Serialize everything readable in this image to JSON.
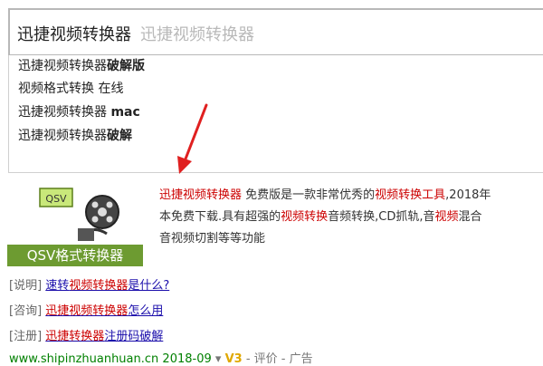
{
  "search": {
    "query": "迅捷视频转换器",
    "hint": "迅捷视频转换器"
  },
  "suggestions": [
    {
      "plain": "迅捷视频转换器",
      "bold": "破解版"
    },
    {
      "plain": "视频格式转换 在线",
      "bold": ""
    },
    {
      "plain": "迅捷视频转换器 ",
      "bold": "mac"
    },
    {
      "plain": "迅捷视频转换器",
      "bold": "破解"
    }
  ],
  "result": {
    "logo_text": "QSV",
    "thumb_label": "QSV格式转换器",
    "line1": {
      "hl1": "迅捷视频转换器",
      "t1": " 免费版是一款非常优秀的",
      "hl2": "视频转换工具",
      "t2": ",2018年"
    },
    "line2": {
      "t1": "本免费下载.具有超强的",
      "hl1": "视频转换",
      "t2": "音频转换,CD抓轨,音",
      "hl2": "视频",
      "t3": "混合"
    },
    "line3": "音视频切割等等功能",
    "subs": [
      {
        "tag": "[说明]",
        "a": "速转",
        "hl": "视频转换器",
        "b": "是什么?"
      },
      {
        "tag": "[咨询]",
        "a": "",
        "hl": "迅捷视频转换器",
        "b": "怎么用"
      },
      {
        "tag": "[注册]",
        "a": "",
        "hl": "迅捷转换器",
        "b": "注册码破解"
      }
    ],
    "url": "www.shipinzhuanhuan.cn",
    "date": "2018-09",
    "v_badge": "V3",
    "trail": "- 评价 - 广告"
  }
}
